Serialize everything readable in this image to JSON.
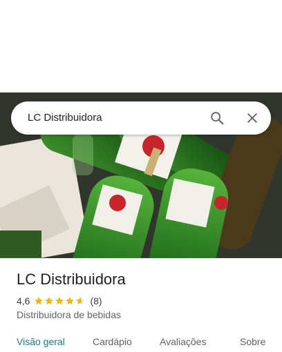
{
  "search": {
    "query": "LC Distribuidora"
  },
  "place": {
    "name": "LC Distribuidora",
    "rating": "4,6",
    "rating_value": 4.6,
    "reviews": "(8)",
    "category": "Distribuidora de bebidas"
  },
  "tabs": [
    {
      "label": "Visão geral",
      "active": true
    },
    {
      "label": "Cardápio",
      "active": false
    },
    {
      "label": "Avaliações",
      "active": false
    },
    {
      "label": "Sobre",
      "active": false
    }
  ],
  "colors": {
    "star": "#f5b400",
    "active_tab": "#1a7a8c"
  },
  "icons": {
    "search": "search-icon",
    "close": "close-icon"
  }
}
